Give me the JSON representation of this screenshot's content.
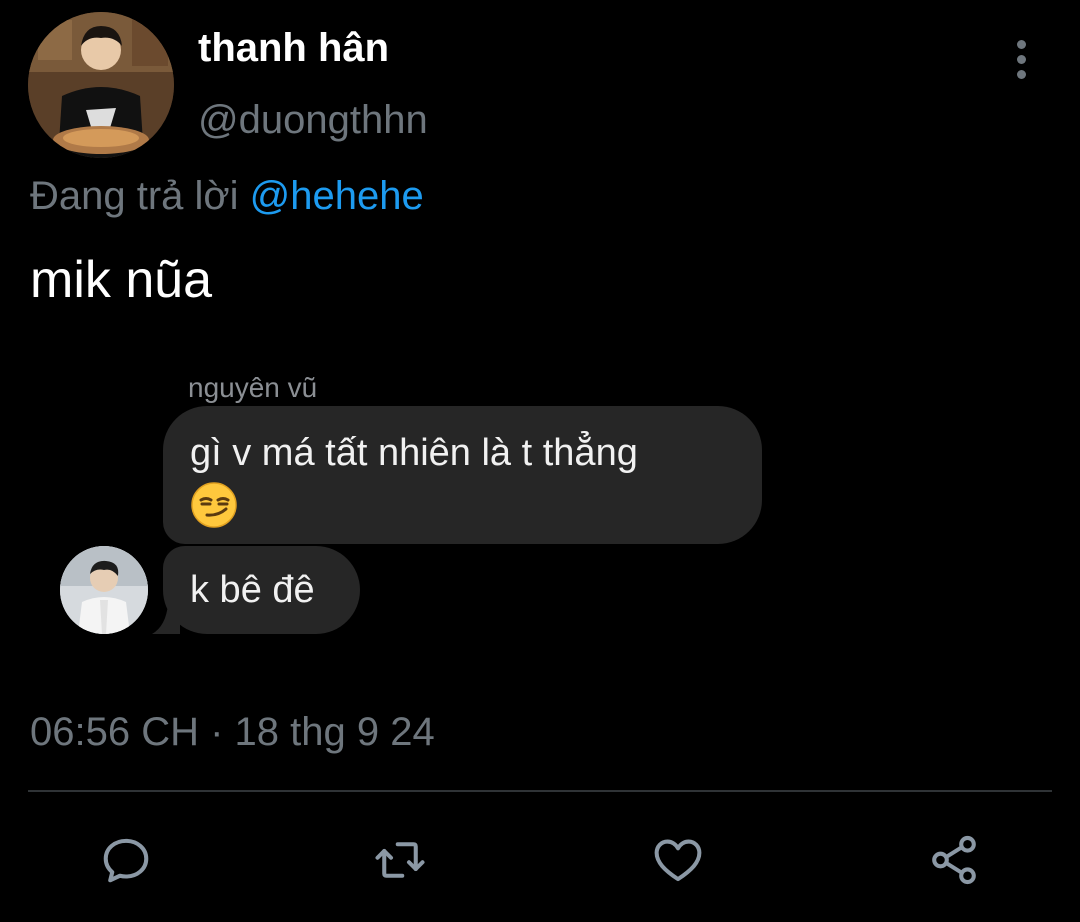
{
  "tweet": {
    "display_name": "thanh hân",
    "handle": "@duongthhn",
    "reply_prefix": "Đang trả lời",
    "reply_mention": "@hehehe",
    "text": "mik nũa",
    "timestamp": "06:56 CH · 18 thg 9 24"
  },
  "embedded_chat": {
    "sender_name": "nguyên vũ",
    "messages": [
      {
        "text": "gì v má tất nhiên là t thẳng",
        "emoji": "smirking-face"
      },
      {
        "text": "k bê đê"
      }
    ]
  },
  "actions": [
    {
      "name": "reply",
      "icon": "speech-bubble-icon"
    },
    {
      "name": "retweet",
      "icon": "retweet-icon"
    },
    {
      "name": "like",
      "icon": "heart-icon"
    },
    {
      "name": "share",
      "icon": "share-icon"
    }
  ],
  "colors": {
    "background": "#000000",
    "primary_text": "#ffffff",
    "secondary_text": "#6e767d",
    "mention": "#1d9bf0",
    "bubble": "#262626",
    "divider": "#2f3336"
  }
}
